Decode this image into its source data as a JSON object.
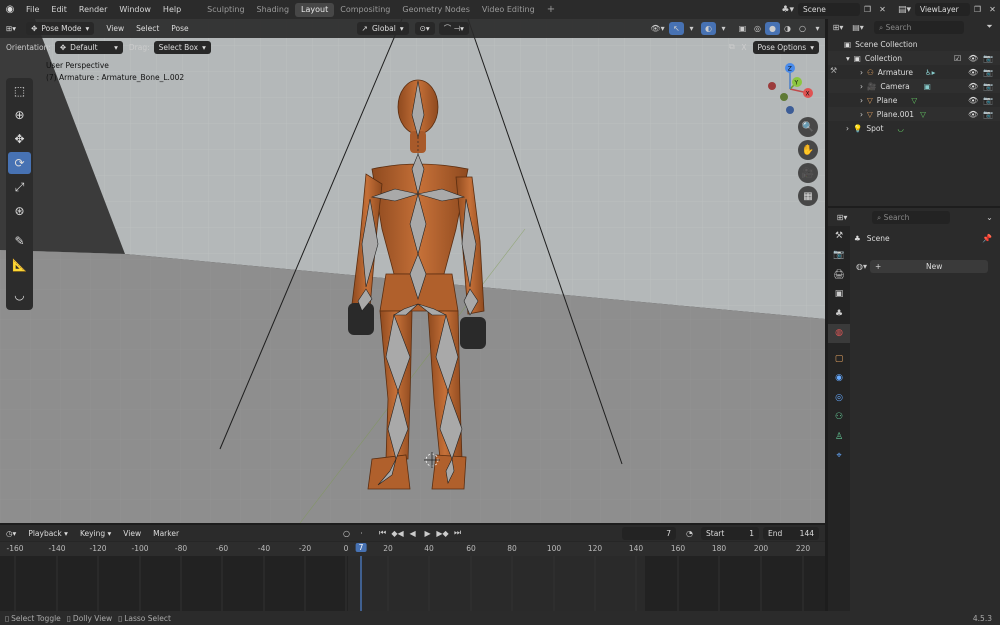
{
  "topbar": {
    "menus": [
      "File",
      "Edit",
      "Render",
      "Window",
      "Help"
    ],
    "workspaces": [
      "Sculpting",
      "Shading",
      "Layout",
      "Compositing",
      "Geometry Nodes",
      "Video Editing"
    ],
    "active_workspace": "Layout",
    "scene": "Scene",
    "view_layer": "ViewLayer"
  },
  "viewport": {
    "mode": "Pose Mode",
    "menus": [
      "View",
      "Select",
      "Pose"
    ],
    "transform_orientation": "Global",
    "orientation_label": "Orientation:",
    "orientation_value": "Default",
    "drag_label": "Drag:",
    "drag_value": "Select Box",
    "pose_options": "Pose Options",
    "overlay_line1": "User Perspective",
    "overlay_line2": "(7) Armature : Armature_Bone_L.002",
    "gizmo_axes": [
      "X",
      "Y",
      "Z"
    ]
  },
  "timeline": {
    "menus": [
      "Playback",
      "Keying",
      "View",
      "Marker"
    ],
    "current_frame": "7",
    "start_label": "Start",
    "start_value": "1",
    "end_label": "End",
    "end_value": "144",
    "ruler": [
      "-160",
      "-140",
      "-120",
      "-100",
      "-80",
      "-60",
      "-40",
      "-20",
      "0",
      "7",
      "20",
      "40",
      "60",
      "80",
      "100",
      "120",
      "140",
      "160",
      "180",
      "200",
      "220"
    ]
  },
  "statusbar": {
    "hints": [
      "Select Toggle",
      "Dolly View",
      "Lasso Select"
    ],
    "version": "4.5.3"
  },
  "outliner": {
    "search_placeholder": "Search",
    "scene_collection": "Scene Collection",
    "collection": "Collection",
    "items": [
      "Armature",
      "Camera",
      "Plane",
      "Plane.001",
      "Spot"
    ]
  },
  "properties": {
    "search_placeholder": "Search",
    "scene_label": "Scene",
    "new_button": "New"
  },
  "colors": {
    "accent": "#4772b3",
    "character": "#b8642e",
    "floor": "#8e8e8e",
    "wall": "#b4b8b9"
  }
}
